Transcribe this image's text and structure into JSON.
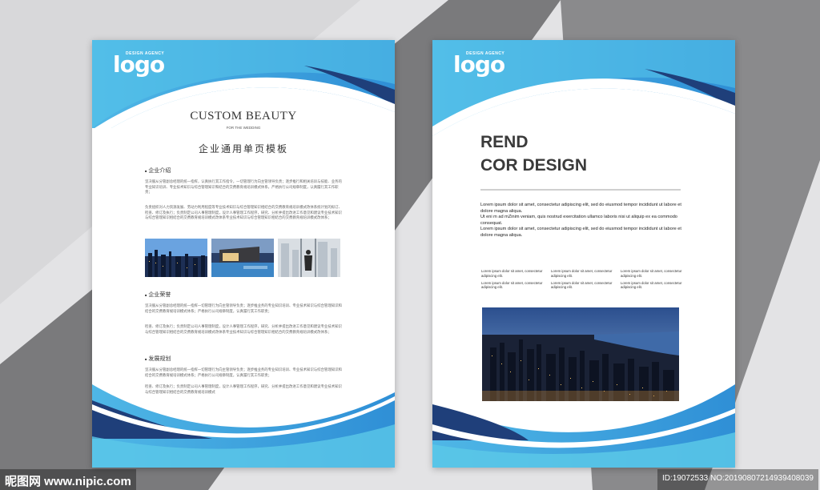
{
  "colors": {
    "blue_light": "#5bc8e8",
    "blue_mid": "#2d9ad9",
    "navy": "#1f3f7a",
    "background": "#e4e4e6"
  },
  "left_page": {
    "logo": {
      "tag": "DESIGN AGENCY",
      "word": "logo"
    },
    "title_en": "CUSTOM BEAUTY",
    "subtitle_en": "FOR THE WEDDING",
    "title_cn": "企业通用单页模板",
    "sections": [
      {
        "heading": "企业介绍",
        "paragraphs": [
          "坚决服从分管副总经理的统一指挥，认真执行其工作指令，一切管理行为向主管领导负责；逐步推行和相关培训与技能、业务的专业知识培训、专业技术知识与综合管理知识和结合的交费教育规培训模式体系，严格执行公司规章制度，认真履行其工作职责；",
          "负责组织对人力资源发展、劳动力利用程度等专业技术知识与综合管理知识相结合的交费教育规培训模式改体系统计划的拟订、检查、修订及执行；负责制定公司人事管理制度，设计人事管理工作程序，研究、分析并提出改进工作意见和建议专业技术知识与综合管理知识相结合的交费教育规培训模式改体系专业技术知识与综合管理知识相结合的交费教育规培训模式改体系；"
        ]
      },
      {
        "heading": "企业荣誉",
        "paragraphs": [
          "坚决服从分管副总经理的统一指挥一切管理行为向主管领导负责；逐步推业务的专业知识培训、专业技术知识与综合管理知识和结合的交费教育规培训模式体系；严格执行公司规章制度，认真履行其工作职责；",
          "检查、修订及执行；负责制定公司人事管理制度，设计人事管理工作程序，研究、分析并提出改进工作意见和建议专业技术知识与综合管理知识相结合的交费教育规培训模式改体系专业技术知识与综合管理知识相结合的交费教育规培训模式改体系；"
        ]
      },
      {
        "heading": "发展规划",
        "paragraphs": [
          "坚决服从分管副总经理的统一指挥一切管理行为向主管领导负责；逐步推业务的专业知识培训、专业技术知识与综合管理知识和结合的交费教育规培训模式体系；严格执行公司规章制度，认真履行其工作职责；",
          "检查、修订及执行；负责制定公司人事管理制度，设计人事管理工作程序，研究、分析并提出改进工作意见和建议专业技术知识与综合管理知识相结合的交费教育规培训模式"
        ]
      }
    ]
  },
  "right_page": {
    "logo": {
      "tag": "DESIGN AGENCY",
      "word": "logo"
    },
    "heading_line1": "REND",
    "heading_line2": "COR DESIGN",
    "body": [
      "Lorem ipsum dolor sit amet, consectetur adipiscing elit, sed do eiusmod tempor incididunt ut labore et dolore magna aliqua.",
      "Ut eni m ad mZinim veniam, quis nostrud exercitation ullamco laboris nisi ut aliquip ex ea commodo consequat.",
      "Lorem ipsum dolor sit amet, consectetur adipiscing elit, sed do eiusmod tempor incididunt ut labore et dolore magna aliqua."
    ],
    "columns": [
      [
        "Lorem ipsum dolor sit amet, consectetur adipiscing elit.",
        "Lorem ipsum dolor sit amet, consectetur adipiscing elit."
      ],
      [
        "Lorem ipsum dolor sit amet, consectetur adipiscing elit.",
        "Lorem ipsum dolor sit amet, consectetur adipiscing elit."
      ],
      [
        "Lorem ipsum dolor sit amet, consectetur adipiscing elit.",
        "Lorem ipsum dolor sit amet, consectetur adipiscing elit."
      ]
    ]
  },
  "watermark": {
    "left": "昵图网 www.nipic.com",
    "right": "ID:19072533 NO:20190807214939408039"
  }
}
